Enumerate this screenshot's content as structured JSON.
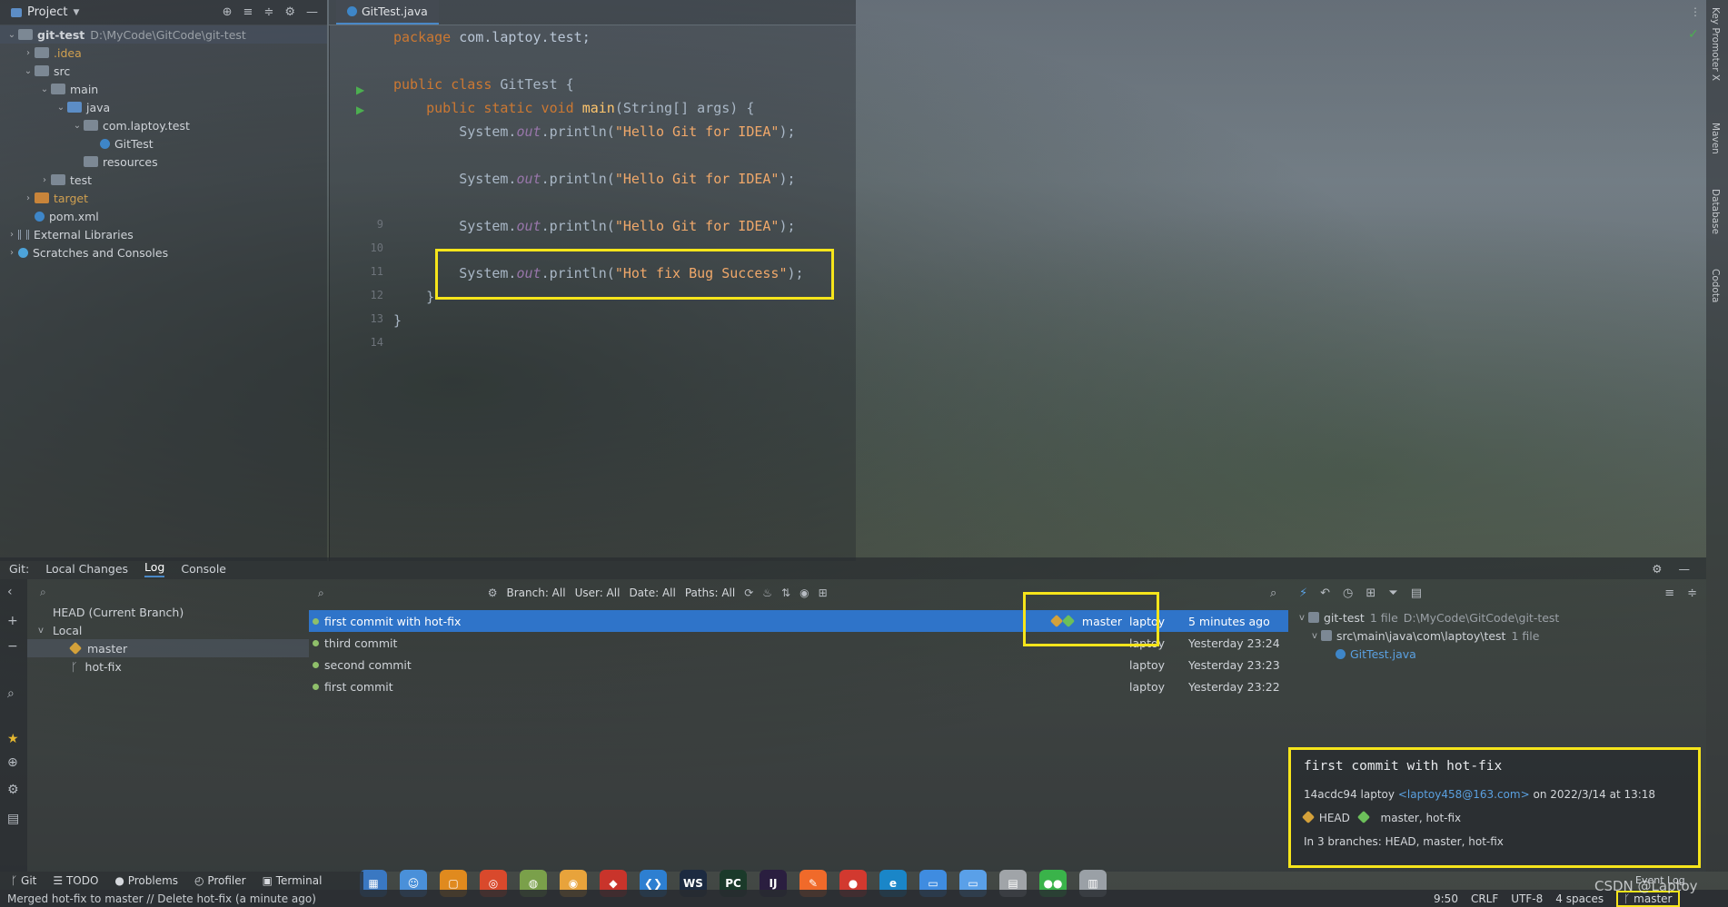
{
  "project": {
    "title": "Project",
    "tree": [
      {
        "label": "git-test",
        "path": "D:\\MyCode\\GitCode\\git-test",
        "depth": 0,
        "arrow": "v",
        "folder": "gray",
        "bold": true
      },
      {
        "label": ".idea",
        "depth": 1,
        "arrow": ">",
        "folder": "gray",
        "style": "orange"
      },
      {
        "label": "src",
        "depth": 1,
        "arrow": "v",
        "folder": "gray"
      },
      {
        "label": "main",
        "depth": 2,
        "arrow": "v",
        "folder": "gray"
      },
      {
        "label": "java",
        "depth": 3,
        "arrow": "v",
        "folder": "blue"
      },
      {
        "label": "com.laptoy.test",
        "depth": 4,
        "arrow": "v",
        "folder": "gray"
      },
      {
        "label": "GitTest",
        "depth": 5,
        "arrow": "",
        "folder": "file"
      },
      {
        "label": "resources",
        "depth": 4,
        "arrow": "",
        "folder": "gray"
      },
      {
        "label": "test",
        "depth": 2,
        "arrow": ">",
        "folder": "gray"
      },
      {
        "label": "target",
        "depth": 1,
        "arrow": ">",
        "folder": "orange",
        "style": "orange"
      },
      {
        "label": "pom.xml",
        "depth": 1,
        "arrow": "",
        "folder": "file"
      },
      {
        "label": "External Libraries",
        "depth": 0,
        "arrow": ">",
        "folder": "lib"
      },
      {
        "label": "Scratches and Consoles",
        "depth": 0,
        "arrow": ">",
        "folder": "scratch"
      }
    ]
  },
  "editor": {
    "tab": "GitTest.java",
    "line_numbers": [
      "9",
      "10",
      "11",
      "12",
      "13",
      "14"
    ],
    "code": {
      "pkg_kw": "package",
      "pkg_name": "com.laptoy.test;",
      "class_kw": "public class",
      "class_name": "GitTest {",
      "main_kw": "public static void",
      "main_sig": "main",
      "main_args": "(String[] args) {",
      "sys": "System.",
      "out": "out",
      "println": ".println(",
      "msg1": "\"Hello Git for IDEA\"",
      "msg_hot": "\"Hot fix Bug Success\"",
      "end": ");",
      "close_method": "}",
      "close_class": "}"
    }
  },
  "right_strip": [
    "Key Promoter X",
    "Maven",
    "Database",
    "Codota"
  ],
  "git": {
    "tabs": [
      "Git:",
      "Local Changes",
      "Log",
      "Console"
    ],
    "active_tab": "Log",
    "branches": {
      "head": "HEAD (Current Branch)",
      "local": "Local",
      "items": [
        "master",
        "hot-fix"
      ]
    },
    "filters": [
      "Branch: All",
      "User: All",
      "Date: All",
      "Paths: All"
    ],
    "commits": [
      {
        "message": "first commit with hot-fix",
        "refs": "master",
        "author": "laptoy",
        "date": "5 minutes ago",
        "selected": true
      },
      {
        "message": "third commit",
        "refs": "",
        "author": "laptoy",
        "date": "Yesterday 23:24",
        "selected": false
      },
      {
        "message": "second commit",
        "refs": "",
        "author": "laptoy",
        "date": "Yesterday 23:23",
        "selected": false
      },
      {
        "message": "first commit",
        "refs": "",
        "author": "laptoy",
        "date": "Yesterday 23:22",
        "selected": false
      }
    ],
    "changes": {
      "root": "git-test",
      "root_info": "1 file",
      "root_path": "D:\\MyCode\\GitCode\\git-test",
      "dir": "src\\main\\java\\com\\laptoy\\test",
      "dir_info": "1 file",
      "file": "GitTest.java"
    },
    "detail": {
      "title": "first commit with hot-fix",
      "hash": "14acdc94",
      "author": "laptoy",
      "email": "<laptoy458@163.com>",
      "on": "on 2022/3/14 at 13:18",
      "head_label": "HEAD",
      "refs": "master, hot-fix",
      "branches": "In 3 branches: HEAD, master, hot-fix"
    }
  },
  "bottom_tools": [
    "Git",
    "TODO",
    "Problems",
    "Profiler",
    "Terminal"
  ],
  "status": {
    "message": "Merged hot-fix to master // Delete hot-fix (a minute ago)",
    "position": "9:50",
    "line_sep": "CRLF",
    "encoding": "UTF-8",
    "indent": "4 spaces",
    "branch": "master",
    "event_log": "Event Log",
    "watermark": "CSDN @Laptoy"
  },
  "taskbar": [
    {
      "name": "start-icon",
      "color": "#3a78c2",
      "glyph": "▦"
    },
    {
      "name": "finder-icon",
      "color": "#4a90d9",
      "glyph": "☺"
    },
    {
      "name": "screen-icon",
      "color": "#e08a1e",
      "glyph": "▢"
    },
    {
      "name": "swirl-icon",
      "color": "#d9492c",
      "glyph": "◎"
    },
    {
      "name": "phone-icon",
      "color": "#7aa04a",
      "glyph": "◍"
    },
    {
      "name": "chrome-canary-icon",
      "color": "#e8a33b",
      "glyph": "◉"
    },
    {
      "name": "redis-icon",
      "color": "#c9342b",
      "glyph": "◆"
    },
    {
      "name": "vscode-icon",
      "color": "#2d7fd1",
      "glyph": "❮❯"
    },
    {
      "name": "webstorm-icon",
      "color": "#1c2a40",
      "glyph": "WS"
    },
    {
      "name": "pycharm-icon",
      "color": "#1b3a2a",
      "glyph": "PC"
    },
    {
      "name": "intellij-icon",
      "color": "#2a1e3f",
      "glyph": "IJ"
    },
    {
      "name": "postman-icon",
      "color": "#f06a2a",
      "glyph": "✎"
    },
    {
      "name": "chrome-icon",
      "color": "#d2392f",
      "glyph": "●"
    },
    {
      "name": "edge-icon",
      "color": "#1a86c8",
      "glyph": "e"
    },
    {
      "name": "folder-icon",
      "color": "#3f8ce0",
      "glyph": "▭"
    },
    {
      "name": "folder2-icon",
      "color": "#5aa0e8",
      "glyph": "▭"
    },
    {
      "name": "notes-icon",
      "color": "#a0a4a8",
      "glyph": "▤"
    },
    {
      "name": "wechat-icon",
      "color": "#3ab34a",
      "glyph": "●●"
    },
    {
      "name": "recycle-bin-icon",
      "color": "#9aa0a6",
      "glyph": "▥"
    }
  ]
}
